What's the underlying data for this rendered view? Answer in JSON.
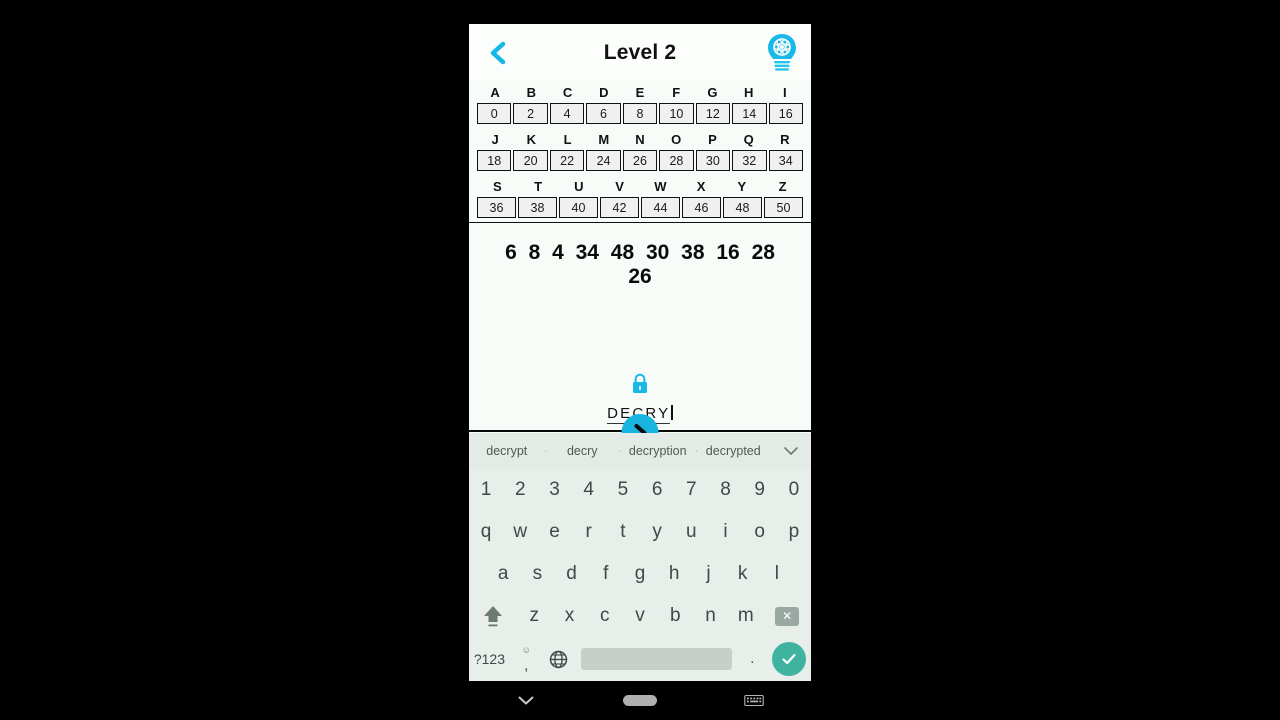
{
  "header": {
    "title": "Level 2",
    "back_icon": "chevron-left-icon",
    "hint_icon": "lightbulb-hint-icon"
  },
  "cipher_table": {
    "rows": [
      {
        "letters": [
          "A",
          "B",
          "C",
          "D",
          "E",
          "F",
          "G",
          "H",
          "I"
        ],
        "values": [
          "0",
          "2",
          "4",
          "6",
          "8",
          "10",
          "12",
          "14",
          "16"
        ]
      },
      {
        "letters": [
          "J",
          "K",
          "L",
          "M",
          "N",
          "O",
          "P",
          "Q",
          "R"
        ],
        "values": [
          "18",
          "20",
          "22",
          "24",
          "26",
          "28",
          "30",
          "32",
          "34"
        ]
      },
      {
        "letters": [
          "S",
          "T",
          "U",
          "V",
          "W",
          "X",
          "Y",
          "Z"
        ],
        "values": [
          "36",
          "38",
          "40",
          "42",
          "44",
          "46",
          "48",
          "50"
        ]
      }
    ]
  },
  "puzzle": {
    "code_line_1": "6  8  4  34  48  30  38  16  28",
    "code_line_2": "26",
    "lock_icon": "lock-icon"
  },
  "answer": {
    "value": "DECRY",
    "submit_icon": "chevron-right-icon"
  },
  "keyboard": {
    "suggestions": [
      "decrypt",
      "decry",
      "decryption",
      "decrypted"
    ],
    "expand_icon": "chevron-down-icon",
    "row_numbers": [
      "1",
      "2",
      "3",
      "4",
      "5",
      "6",
      "7",
      "8",
      "9",
      "0"
    ],
    "row_top": [
      "q",
      "w",
      "e",
      "r",
      "t",
      "y",
      "u",
      "i",
      "o",
      "p"
    ],
    "row_home": [
      "a",
      "s",
      "d",
      "f",
      "g",
      "h",
      "j",
      "k",
      "l"
    ],
    "row_bottom_letters": [
      "z",
      "x",
      "c",
      "v",
      "b",
      "n",
      "m"
    ],
    "shift_icon": "shift-icon",
    "backspace_icon": "backspace-icon",
    "symbols_key": "?123",
    "comma_key": ",",
    "emoji_hint": "☺",
    "globe_icon": "globe-icon",
    "space_key": "",
    "period_key": ".",
    "enter_icon": "check-icon"
  },
  "navbar": {
    "hide_keyboard_icon": "chevron-down-icon",
    "home_icon": "home-pill-icon",
    "switch_keyboard_icon": "keyboard-icon"
  },
  "colors": {
    "accent_cyan": "#18b4e0",
    "enter_teal": "#3fb3a0",
    "screen_bg": "#f7fcf8",
    "keyboard_bg": "#e8eeea"
  }
}
